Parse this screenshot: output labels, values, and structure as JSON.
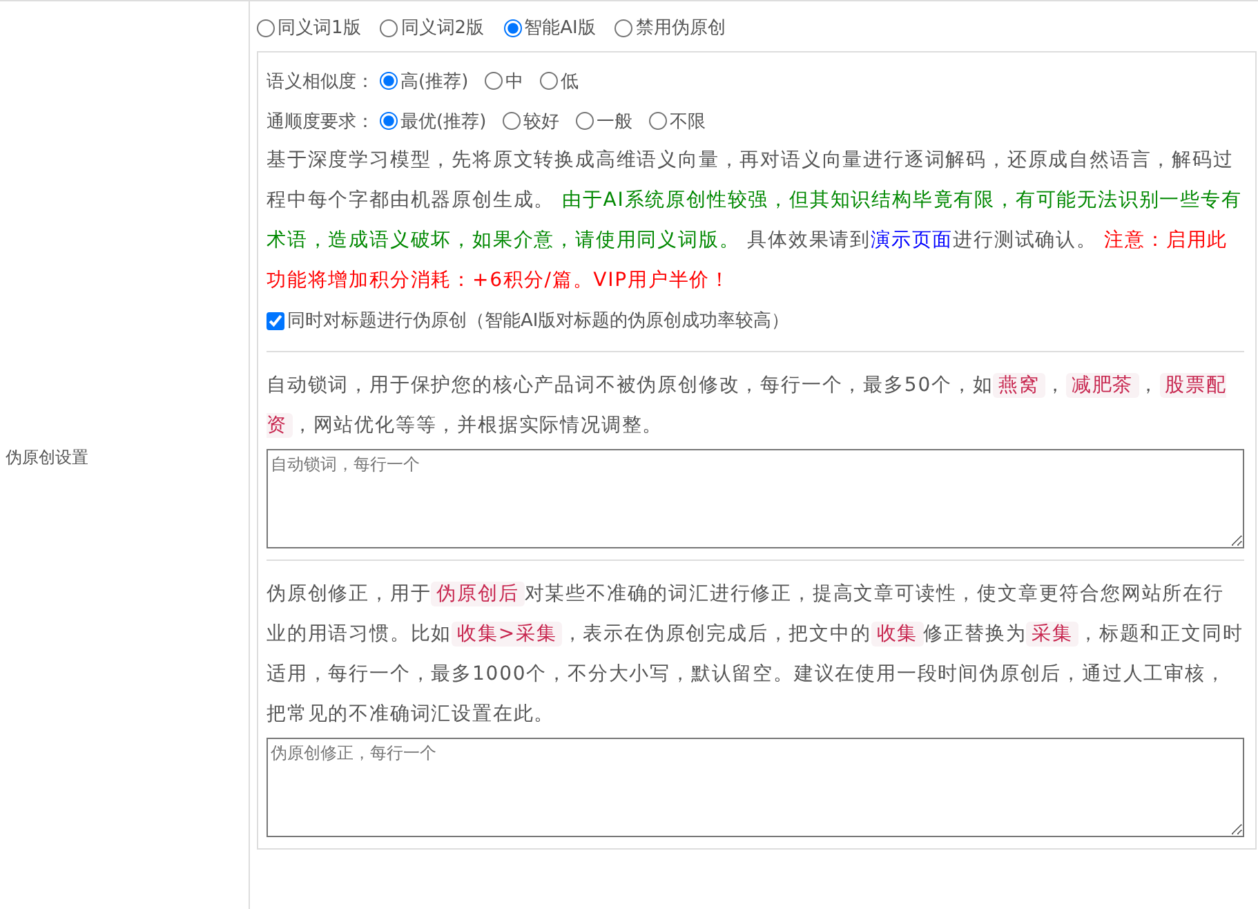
{
  "mode_options": [
    {
      "label": "同义词1版",
      "selected": false
    },
    {
      "label": "同义词2版",
      "selected": false
    },
    {
      "label": "智能AI版",
      "selected": true
    },
    {
      "label": "禁用伪原创",
      "selected": false
    }
  ],
  "similarity": {
    "label": "语义相似度：",
    "options": [
      {
        "label": "高(推荐)",
        "selected": true
      },
      {
        "label": "中",
        "selected": false
      },
      {
        "label": "低",
        "selected": false
      }
    ]
  },
  "fluency": {
    "label": "通顺度要求：",
    "options": [
      {
        "label": "最优(推荐)",
        "selected": true
      },
      {
        "label": "较好",
        "selected": false
      },
      {
        "label": "一般",
        "selected": false
      },
      {
        "label": "不限",
        "selected": false
      }
    ]
  },
  "ai_description": [
    {
      "kind": "plain",
      "text": "基于深度学习模型，先将原文转换成高维语义向量，再对语义向量进行逐词解码，还原成自然语言，解码过程中每个字都由机器原创生成。 "
    },
    {
      "kind": "green",
      "text": "由于AI系统原创性较强，但其知识结构毕竟有限，有可能无法识别一些专有术语，造成语义破坏，如果介意，请使用同义词版。"
    },
    {
      "kind": "plain",
      "text": " 具体效果请到"
    },
    {
      "kind": "link",
      "text": "演示页面"
    },
    {
      "kind": "plain",
      "text": "进行测试确认。 "
    },
    {
      "kind": "red",
      "text": "注意：启用此功能将增加积分消耗：+6积分/篇。VIP用户半价！"
    }
  ],
  "title_option": {
    "label": "同时对标题进行伪原创（智能AI版对标题的伪原创成功率较高）",
    "checked": true
  },
  "side_label": "伪原创设置",
  "lock_description": [
    {
      "kind": "plain",
      "text": "自动锁词，用于保护您的核心产品词不被伪原创修改，每行一个，最多50个，如"
    },
    {
      "kind": "tag",
      "text": "燕窝"
    },
    {
      "kind": "plain",
      "text": "，"
    },
    {
      "kind": "tag",
      "text": "减肥茶"
    },
    {
      "kind": "plain",
      "text": "，"
    },
    {
      "kind": "tag",
      "text": "股票配资"
    },
    {
      "kind": "plain",
      "text": "，网站优化等等，并根据实际情况调整。"
    }
  ],
  "lock_field": {
    "placeholder": "自动锁词，每行一个"
  },
  "fix_description": [
    {
      "kind": "plain",
      "text": "伪原创修正，用于"
    },
    {
      "kind": "tag",
      "text": "伪原创后"
    },
    {
      "kind": "plain",
      "text": "对某些不准确的词汇进行修正，提高文章可读性，使文章更符合您网站所在行业的用语习惯。比如"
    },
    {
      "kind": "tag",
      "text": "收集>采集"
    },
    {
      "kind": "plain",
      "text": "，表示在伪原创完成后，把文中的"
    },
    {
      "kind": "tag",
      "text": "收集"
    },
    {
      "kind": "plain",
      "text": "修正替换为"
    },
    {
      "kind": "tag",
      "text": "采集"
    },
    {
      "kind": "plain",
      "text": "，标题和正文同时适用，每行一个，最多1000个，不分大小写，默认留空。建议在使用一段时间伪原创后，通过人工审核，把常见的不准确词汇设置在此。"
    }
  ],
  "fix_field": {
    "placeholder": "伪原创修正，每行一个"
  }
}
